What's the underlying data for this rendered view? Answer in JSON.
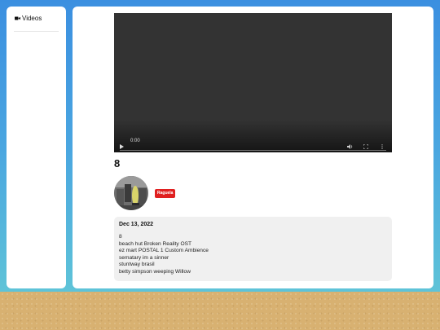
{
  "sidebar": {
    "items": [
      {
        "label": "Videos",
        "icon": "video-camera-icon"
      }
    ]
  },
  "player": {
    "time": "0:00",
    "progress": 0
  },
  "video": {
    "title": "8",
    "channel_badge": "Raguelа",
    "date": "Dec 13, 2022",
    "description_lines": [
      "8",
      "beach hut Broken Reality OST",
      "ez mart POSTAL 1 Custom Ambience",
      "sematary im a sinner",
      "stuntway brasil",
      "betty simpson weeping Willow"
    ]
  },
  "colors": {
    "badge": "#e02020",
    "background_top": "#3b8fe0",
    "background_bottom": "#5ec3d8",
    "sand": "#d8b171"
  }
}
